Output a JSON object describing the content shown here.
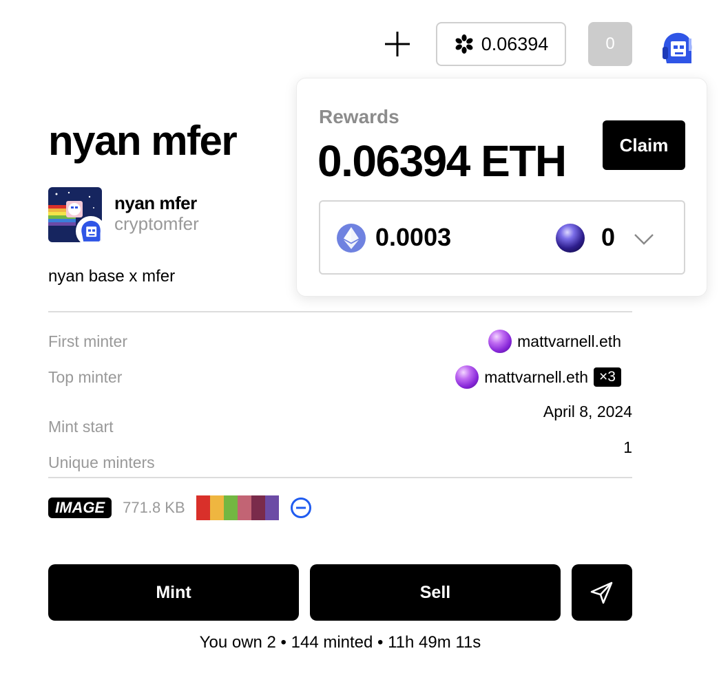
{
  "header": {
    "plus_icon": "plus-icon",
    "balance_icon": "asterisk-icon",
    "balance": "0.06394",
    "notifications_count": "0",
    "avatar_icon": "mfer-avatar"
  },
  "token": {
    "title": "nyan mfer",
    "creator_name": "nyan mfer",
    "creator_handle": "cryptomfer",
    "description": "nyan base x mfer"
  },
  "details": [
    {
      "label": "First minter",
      "value": "mattvarnell.eth"
    },
    {
      "label": "Top minter",
      "value": "mattvarnell.eth",
      "badge": "×3"
    },
    {
      "label": "Mint start",
      "value": "April 8, 2024"
    },
    {
      "label": "Unique minters",
      "value": "1"
    }
  ],
  "media": {
    "type_label": "IMAGE",
    "file_size": "771.8 KB",
    "palette": [
      "#d9302a",
      "#efb640",
      "#73b742",
      "#c26474",
      "#7a2b4b",
      "#6c4ba5"
    ],
    "chain_icon": "base-chain-icon"
  },
  "actions": {
    "mint_label": "Mint",
    "sell_label": "Sell",
    "share_icon": "send-icon"
  },
  "status_line": "You own 2 • 144 minted • 11h 49m 11s",
  "rewards": {
    "label": "Rewards",
    "amount": "0.06394 ETH",
    "claim_label": "Claim",
    "eth_amount": "0.0003",
    "token_amount": "0"
  }
}
